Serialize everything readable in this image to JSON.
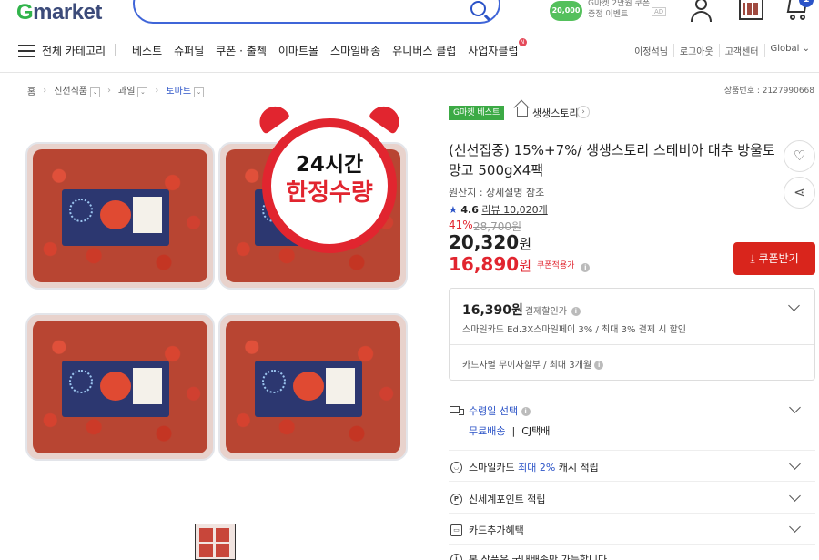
{
  "header": {
    "logo_g": "G",
    "logo_rest": "market",
    "promo_coin": "20,000",
    "promo_line1": "G마켓 2만원 쿠폰",
    "promo_line2": "증정 이벤트",
    "promo_ad": "AD",
    "cart_count": "1"
  },
  "nav": {
    "all_categories": "전체 카테고리",
    "menu": [
      "베스트",
      "슈퍼딜",
      "쿠폰 · 출첵",
      "이마트몰",
      "스마일배송",
      "유니버스 클럽",
      "사업자클럽"
    ],
    "biz_badge": "N",
    "util": [
      "이정석님",
      "로그아웃",
      "고객센터",
      "Global ⌄"
    ]
  },
  "breadcrumb": {
    "items": [
      "홈",
      "신선식품",
      "과일",
      "토마토"
    ],
    "dropdown_glyph": "⌄",
    "separator": "›"
  },
  "product_number": "상품번호 : 2127990668",
  "image_badge": {
    "line1": "24시간",
    "line2": "한정수량"
  },
  "seller": {
    "badge": "G마켓 베스트",
    "name": "생생스토리",
    "go": "›"
  },
  "product": {
    "title": "(신선집중) 15%+7%/ 생생스토리 스테비아 대추 방울토망고 500gX4팩",
    "origin": "원산지 : 상세설명 참조",
    "rating": "4.6",
    "review_count": "리뷰 10,020개",
    "discount_pct": "41%",
    "original_price": "28,700원",
    "price_num": "20,320",
    "price_unit": "원",
    "coupon_price_num": "16,890",
    "coupon_price_unit": "원",
    "coupon_label": "쿠폰적용가",
    "coupon_button": "쿠폰받기"
  },
  "payment": {
    "price": "16,390원",
    "label": "결제할인가",
    "detail": "스마일카드 Ed.3X스마일페이 3% / 최대 3% 결제 시 할인",
    "installment": "카드사별 무이자할부 / 최대 3개월"
  },
  "rows": {
    "delivery_title": "수령일 선택",
    "delivery_free": "무료배송",
    "delivery_courier": "CJ택배",
    "smile_pre": "스마일카드",
    "smile_blue": "최대 2%",
    "smile_post": "캐시 적립",
    "shinsegae": "신세계포인트 적립",
    "card_benefit": "카드추가혜택",
    "bundle": "본 상품은 국내배송만 가능합니다"
  }
}
